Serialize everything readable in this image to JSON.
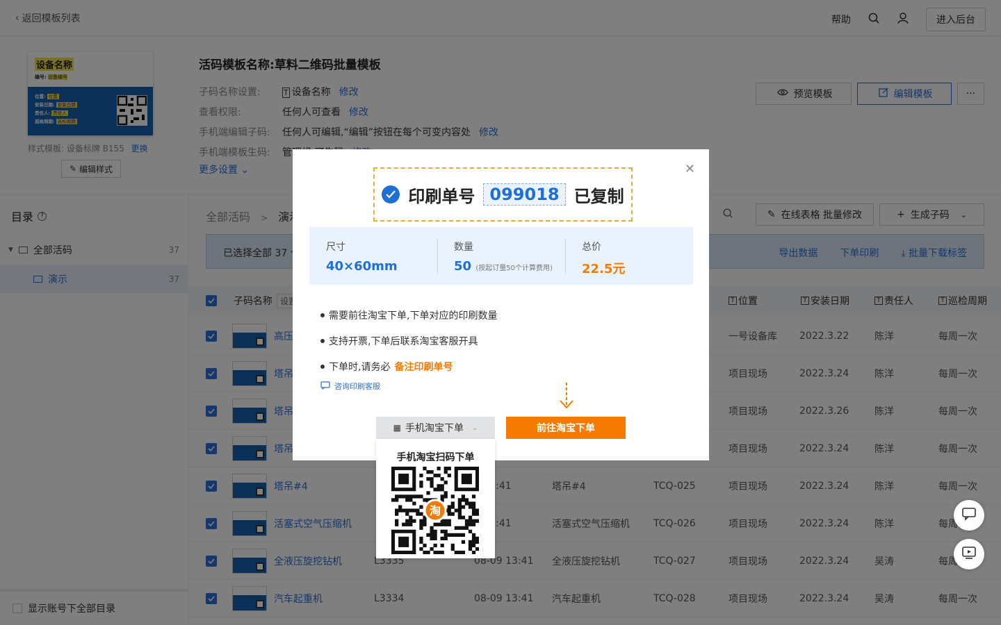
{
  "topbar": {
    "back_label": "返回模板列表",
    "help_label": "帮助",
    "admin_label": "进入后台"
  },
  "template": {
    "card_name": "设备名称",
    "card_no_label": "编号:",
    "card_no_value": "设备编号",
    "card_fields": [
      {
        "k": "位置:",
        "v": "位置"
      },
      {
        "k": "安装日期:",
        "v": "安装日期"
      },
      {
        "k": "责任人:",
        "v": "责任人"
      },
      {
        "k": "巡检周期:",
        "v": "巡检周期"
      }
    ],
    "style_label": "样式模板:",
    "style_value": "设备标牌 B155",
    "change_label": "更换",
    "edit_style_label": "编辑样式",
    "title_label": "活码模板名称:",
    "title_value": "草料二维码批量模板",
    "meta": [
      {
        "k": "子码名称设置:",
        "v": "设备名称",
        "action": "修改"
      },
      {
        "k": "查看权限:",
        "v": "任何人可查看",
        "action": "修改"
      },
      {
        "k": "手机端编辑子码:",
        "v": "任何人可编辑,“编辑”按钮在每个可变内容处",
        "action": "修改"
      },
      {
        "k": "手机端模板生码:",
        "v": "管理组 可生码",
        "action": "修改"
      }
    ],
    "more_settings_label": "更多设置",
    "preview_label": "预览模板",
    "edit_template_label": "编辑模板",
    "more_label": "···"
  },
  "sidebar": {
    "title": "目录",
    "items": [
      {
        "label": "全部活码",
        "count": "37"
      },
      {
        "label": "演示",
        "count": "37"
      }
    ],
    "footer_label": "显示账号下全部目录"
  },
  "main": {
    "crumb_root": "全部活码",
    "crumb_sep": ">",
    "crumb_current": "演示",
    "batch_edit_label": "在线表格 批量修改",
    "generate_label": "生成子码",
    "selected_text": "已选择全部 37 个",
    "export_label": "导出数据",
    "print_label": "下单印刷",
    "download_label": "批量下载标签",
    "headers": {
      "name": "子码名称",
      "name_tag": "设置",
      "location": "位置",
      "install_date": "安装日期",
      "owner": "责任人",
      "cycle": "巡检周期"
    },
    "rows": [
      {
        "name": "高压",
        "code": "",
        "time": "",
        "title": "",
        "no": "",
        "location": "一号设备库",
        "date": "2022.3.22",
        "owner": "陈洋",
        "cycle": "每周一次"
      },
      {
        "name": "塔吊",
        "code": "",
        "time": "",
        "title": "",
        "no": "",
        "location": "项目现场",
        "date": "2022.3.24",
        "owner": "陈洋",
        "cycle": "每周一次"
      },
      {
        "name": "塔吊",
        "code": "",
        "time": "",
        "title": "",
        "no": "",
        "location": "项目现场",
        "date": "2022.3.26",
        "owner": "陈洋",
        "cycle": "每周一次"
      },
      {
        "name": "塔吊",
        "code": "",
        "time": "",
        "title": "",
        "no": "",
        "location": "项目现场",
        "date": "2022.3.24",
        "owner": "陈洋",
        "cycle": "每周一次"
      },
      {
        "name": "塔吊#4",
        "code": "",
        "time": "9 13:41",
        "title": "塔吊#4",
        "no": "TCQ-025",
        "location": "项目现场",
        "date": "2022.3.24",
        "owner": "陈洋",
        "cycle": "每周一次"
      },
      {
        "name": "活塞式空气压缩机",
        "code": "",
        "time": "9 13:41",
        "title": "活塞式空气压缩机",
        "no": "TCQ-026",
        "location": "项目现场",
        "date": "2022.3.24",
        "owner": "陈洋",
        "cycle": "每周"
      },
      {
        "name": "全液压旋挖钻机",
        "code": "L3335",
        "time": "08-09 13:41",
        "title": "全液压旋挖钻机",
        "no": "TCQ-027",
        "location": "项目现场",
        "date": "2022.3.24",
        "owner": "吴涛",
        "cycle": "每周"
      },
      {
        "name": "汽车起重机",
        "code": "L3334",
        "time": "08-09 13:41",
        "title": "汽车起重机",
        "no": "TCQ-028",
        "location": "项目现场",
        "date": "2022.3.24",
        "owner": "吴涛",
        "cycle": "每周一次"
      }
    ]
  },
  "modal": {
    "heading_prefix": "印刷单号",
    "order_no": "099018",
    "heading_suffix": "已复制",
    "size_label": "尺寸",
    "size_value": "40×60mm",
    "qty_label": "数量",
    "qty_value": "50",
    "qty_note": "(按起订量50个计算费用)",
    "price_label": "总价",
    "price_value": "22.5元",
    "bullets": [
      {
        "text": "需要前往淘宝下单,下单对应的印刷数量",
        "hl": ""
      },
      {
        "text": "支持开票,下单后联系淘宝客服开具",
        "hl": ""
      },
      {
        "text": "下单时,请务必",
        "hl": "备注印刷单号"
      }
    ],
    "consult_label": "咨询印刷客服",
    "mobile_label": "手机淘宝下单",
    "go_label": "前往淘宝下单",
    "qr_title": "手机淘宝扫码下单",
    "qr_badge": "淘"
  },
  "colors": {
    "accent": "#2d6fd6",
    "orange": "#f57a00",
    "label_blue": "#1760b0",
    "highlight_yellow": "#f7e24a"
  }
}
